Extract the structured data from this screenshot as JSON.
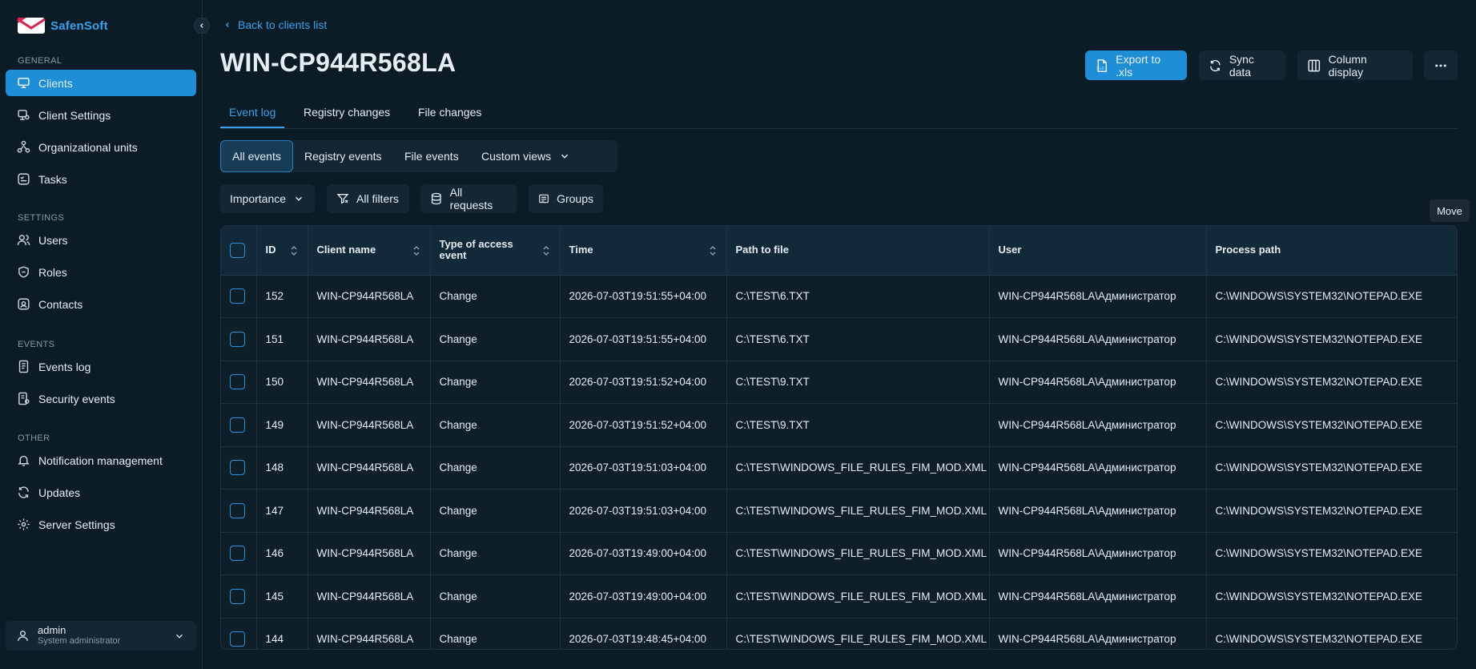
{
  "app": {
    "brand": "SafenSoft"
  },
  "sidebar": {
    "sections": {
      "general": "GENERAL",
      "settings": "SETTINGS",
      "events": "EVENTS",
      "other": "OTHER"
    },
    "items": [
      {
        "label": "Clients",
        "icon": "monitor-icon",
        "active": true
      },
      {
        "label": "Client Settings",
        "icon": "monitor-settings-icon"
      },
      {
        "label": "Organizational units",
        "icon": "org-units-icon"
      },
      {
        "label": "Tasks",
        "icon": "tasks-icon"
      },
      {
        "label": "Users",
        "icon": "users-icon"
      },
      {
        "label": "Roles",
        "icon": "shield-icon"
      },
      {
        "label": "Contacts",
        "icon": "contacts-icon"
      },
      {
        "label": "Events log",
        "icon": "document-icon"
      },
      {
        "label": "Security events",
        "icon": "security-document-icon"
      },
      {
        "label": "Notification management",
        "icon": "bell-icon"
      },
      {
        "label": "Updates",
        "icon": "refresh-icon"
      },
      {
        "label": "Server Settings",
        "icon": "gear-icon"
      }
    ],
    "user": {
      "name": "admin",
      "role": "System administrator"
    }
  },
  "header": {
    "back_label": "Back to clients list",
    "title": "WIN-CP944R568LA",
    "export_label": "Export to .xls",
    "sync_label": "Sync data",
    "columns_label": "Column display"
  },
  "tabs": [
    "Event log",
    "Registry changes",
    "File changes"
  ],
  "segments": [
    "All events",
    "Registry events",
    "File events",
    "Custom views"
  ],
  "filters": {
    "importance": "Importance",
    "all_filters": "All filters",
    "all_requests": "All requests",
    "groups": "Groups"
  },
  "tooltip": "Move",
  "table": {
    "columns": [
      "ID",
      "Client name",
      "Type of access event",
      "Time",
      "Path to file",
      "User",
      "Process path"
    ],
    "rows": [
      [
        "152",
        "WIN-CP944R568LA",
        "Change",
        "2026-07-03T19:51:55+04:00",
        "C:\\TEST\\6.TXT",
        "WIN-CP944R568LA\\Администратор",
        "C:\\WINDOWS\\SYSTEM32\\NOTEPAD.EXE"
      ],
      [
        "151",
        "WIN-CP944R568LA",
        "Change",
        "2026-07-03T19:51:55+04:00",
        "C:\\TEST\\6.TXT",
        "WIN-CP944R568LA\\Администратор",
        "C:\\WINDOWS\\SYSTEM32\\NOTEPAD.EXE"
      ],
      [
        "150",
        "WIN-CP944R568LA",
        "Change",
        "2026-07-03T19:51:52+04:00",
        "C:\\TEST\\9.TXT",
        "WIN-CP944R568LA\\Администратор",
        "C:\\WINDOWS\\SYSTEM32\\NOTEPAD.EXE"
      ],
      [
        "149",
        "WIN-CP944R568LA",
        "Change",
        "2026-07-03T19:51:52+04:00",
        "C:\\TEST\\9.TXT",
        "WIN-CP944R568LA\\Администратор",
        "C:\\WINDOWS\\SYSTEM32\\NOTEPAD.EXE"
      ],
      [
        "148",
        "WIN-CP944R568LA",
        "Change",
        "2026-07-03T19:51:03+04:00",
        "C:\\TEST\\WINDOWS_FILE_RULES_FIM_MOD.XML",
        "WIN-CP944R568LA\\Администратор",
        "C:\\WINDOWS\\SYSTEM32\\NOTEPAD.EXE"
      ],
      [
        "147",
        "WIN-CP944R568LA",
        "Change",
        "2026-07-03T19:51:03+04:00",
        "C:\\TEST\\WINDOWS_FILE_RULES_FIM_MOD.XML",
        "WIN-CP944R568LA\\Администратор",
        "C:\\WINDOWS\\SYSTEM32\\NOTEPAD.EXE"
      ],
      [
        "146",
        "WIN-CP944R568LA",
        "Change",
        "2026-07-03T19:49:00+04:00",
        "C:\\TEST\\WINDOWS_FILE_RULES_FIM_MOD.XML",
        "WIN-CP944R568LA\\Администратор",
        "C:\\WINDOWS\\SYSTEM32\\NOTEPAD.EXE"
      ],
      [
        "145",
        "WIN-CP944R568LA",
        "Change",
        "2026-07-03T19:49:00+04:00",
        "C:\\TEST\\WINDOWS_FILE_RULES_FIM_MOD.XML",
        "WIN-CP944R568LA\\Администратор",
        "C:\\WINDOWS\\SYSTEM32\\NOTEPAD.EXE"
      ],
      [
        "144",
        "WIN-CP944R568LA",
        "Change",
        "2026-07-03T19:48:45+04:00",
        "C:\\TEST\\WINDOWS_FILE_RULES_FIM_MOD.XML",
        "WIN-CP944R568LA\\Администратор",
        "C:\\WINDOWS\\SYSTEM32\\NOTEPAD.EXE"
      ]
    ]
  },
  "colors": {
    "accent": "#1e8fd6",
    "background": "#0c1c26",
    "panel": "#142633"
  }
}
